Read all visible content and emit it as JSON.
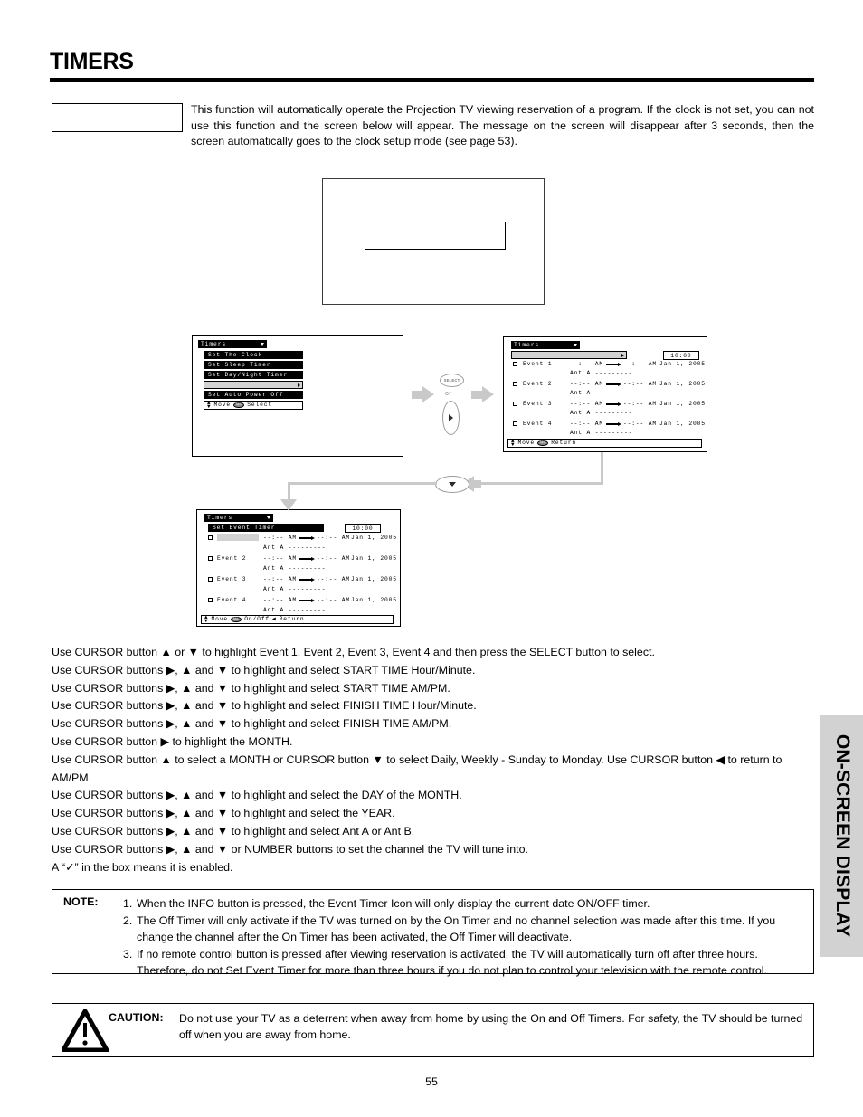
{
  "page": {
    "title": "TIMERS",
    "number": "55",
    "side_tab": "ON-SCREEN DISPLAY"
  },
  "intro": {
    "box_label": "",
    "text": "This function will automatically operate the Projection TV viewing reservation of a program.  If the clock is not set, you can not use this function and the screen below will appear.  The message on the screen will disappear after 3 seconds, then the screen automatically goes to the clock setup mode (see page 53)."
  },
  "tv_screen": {
    "message": ""
  },
  "osd_panels": [
    {
      "id": "timers-menu",
      "title": "Timers",
      "items": [
        {
          "label": "Set The Clock",
          "highlighted": false
        },
        {
          "label": "Set Sleep Timer",
          "highlighted": false
        },
        {
          "label": "Set Day/Night Timer",
          "highlighted": false
        },
        {
          "label": "",
          "highlighted": true
        },
        {
          "label": "Set Auto Power Off",
          "highlighted": false
        }
      ],
      "guide": {
        "move": "Move",
        "sel": "SEL",
        "action": "Select"
      }
    },
    {
      "id": "event-timer-list",
      "title": "Timers",
      "subtitle": "",
      "subtitle_highlighted": true,
      "clock": "10:00",
      "events": [
        {
          "name": "Event 1",
          "highlighted": false,
          "start": "--:-- AM",
          "finish": "--:-- AM",
          "date": "Jan 1, 2005",
          "ant": "Ant A ---------"
        },
        {
          "name": "Event 2",
          "highlighted": false,
          "start": "--:-- AM",
          "finish": "--:-- AM",
          "date": "Jan 1, 2005",
          "ant": "Ant A ---------"
        },
        {
          "name": "Event 3",
          "highlighted": false,
          "start": "--:-- AM",
          "finish": "--:-- AM",
          "date": "Jan 1, 2005",
          "ant": "Ant A ---------"
        },
        {
          "name": "Event 4",
          "highlighted": false,
          "start": "--:-- AM",
          "finish": "--:-- AM",
          "date": "Jan 1, 2005",
          "ant": "Ant A ---------"
        }
      ],
      "guide": {
        "move": "Move",
        "sel": "SEL",
        "action": "Return"
      }
    },
    {
      "id": "set-event-timer",
      "title": "Timers",
      "subtitle": "Set Event Timer",
      "subtitle_highlighted": false,
      "clock": "10:00",
      "events": [
        {
          "name": "",
          "highlighted": true,
          "start": "--:-- AM",
          "finish": "--:-- AM",
          "date": "Jan 1, 2005",
          "ant": "Ant A ---------"
        },
        {
          "name": "Event 2",
          "highlighted": false,
          "start": "--:-- AM",
          "finish": "--:-- AM",
          "date": "Jan 1, 2005",
          "ant": "Ant A ---------"
        },
        {
          "name": "Event 3",
          "highlighted": false,
          "start": "--:-- AM",
          "finish": "--:-- AM",
          "date": "Jan 1, 2005",
          "ant": "Ant A ---------"
        },
        {
          "name": "Event 4",
          "highlighted": false,
          "start": "--:-- AM",
          "finish": "--:-- AM",
          "date": "Jan 1, 2005",
          "ant": "Ant A ---------"
        }
      ],
      "guide": {
        "move": "Move",
        "sel": "SEL",
        "action": "On/Off",
        "action2": "Return"
      }
    }
  ],
  "flow": {
    "select_button": "SELECT",
    "or_label": "or"
  },
  "instructions": [
    "Use CURSOR button ▲ or ▼ to highlight Event 1, Event 2, Event 3, Event 4 and then press the SELECT button to select.",
    "Use CURSOR buttons ▶, ▲ and ▼ to highlight and select START TIME Hour/Minute.",
    "Use CURSOR buttons ▶, ▲ and ▼ to highlight and select START TIME AM/PM.",
    "Use CURSOR buttons ▶, ▲ and ▼ to highlight and select FINISH TIME Hour/Minute.",
    "Use CURSOR buttons ▶, ▲ and ▼ to highlight and select FINISH TIME AM/PM.",
    "Use CURSOR button ▶ to highlight the MONTH.",
    "Use CURSOR button ▲ to select a MONTH or CURSOR button ▼ to select Daily, Weekly - Sunday to Monday.  Use CURSOR button ◀ to return to AM/PM.",
    "Use CURSOR buttons ▶, ▲ and ▼ to highlight and select the DAY of the MONTH.",
    "Use CURSOR buttons ▶, ▲ and ▼ to highlight and select the YEAR.",
    "Use CURSOR buttons ▶, ▲ and ▼ to highlight and select Ant A or Ant B.",
    "Use CURSOR buttons ▶, ▲ and ▼ or NUMBER buttons to set the channel the TV will tune into.",
    "A “✓” in the box means it is enabled."
  ],
  "note": {
    "label": "NOTE:",
    "items": [
      {
        "num": "1.",
        "text": "When the INFO button is pressed, the Event Timer Icon will only display the current date ON/OFF timer."
      },
      {
        "num": "2.",
        "text": "The Off Timer will only activate if the TV was turned on by the On Timer and no channel selection was made after this time.  If you change the channel after the On Timer has been activated, the Off Timer will deactivate."
      },
      {
        "num": "3.",
        "text": "If no remote control button is pressed after viewing reservation is activated, the TV will automatically turn off after three hours.  Therefore, do not Set Event Timer for more than three hours if you do not plan to control your television with the remote control."
      }
    ]
  },
  "caution": {
    "label": "CAUTION:",
    "text": "Do not use your TV as a deterrent when away from home by using the On and Off Timers.  For safety, the TV should be turned off when you are away from home."
  }
}
